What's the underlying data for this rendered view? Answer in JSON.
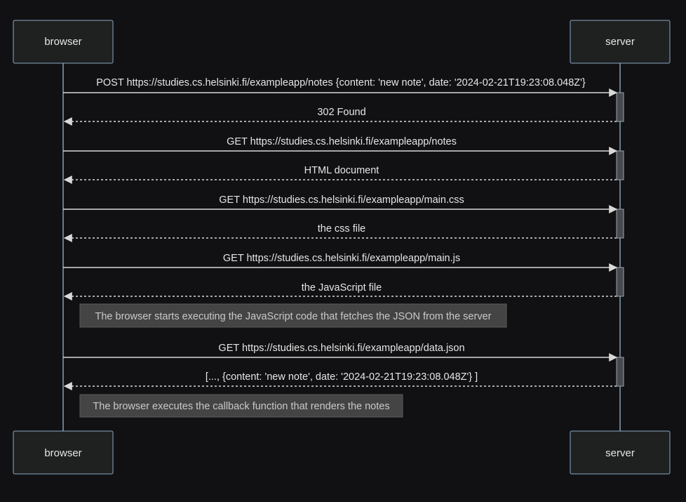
{
  "actors": {
    "left": "browser",
    "right": "server"
  },
  "messages": [
    {
      "text": "POST https://studies.cs.helsinki.fi/exampleapp/notes {content: 'new note', date: '2024-02-21T19:23:08.048Z'}",
      "direction": "request"
    },
    {
      "text": "302 Found",
      "direction": "response"
    },
    {
      "text": "GET https://studies.cs.helsinki.fi/exampleapp/notes",
      "direction": "request"
    },
    {
      "text": "HTML document",
      "direction": "response"
    },
    {
      "text": "GET https://studies.cs.helsinki.fi/exampleapp/main.css",
      "direction": "request"
    },
    {
      "text": "the css file",
      "direction": "response"
    },
    {
      "text": "GET https://studies.cs.helsinki.fi/exampleapp/main.js",
      "direction": "request"
    },
    {
      "text": "the JavaScript file",
      "direction": "response"
    },
    {
      "text": "GET https://studies.cs.helsinki.fi/exampleapp/data.json",
      "direction": "request"
    },
    {
      "text": "[..., {content: 'new note', date: '2024-02-21T19:23:08.048Z'} ]",
      "direction": "response"
    }
  ],
  "notes": [
    {
      "text": "The browser starts executing the JavaScript code that fetches the JSON from the server"
    },
    {
      "text": "The browser executes the callback function that renders the notes"
    }
  ],
  "colors": {
    "background": "#111113",
    "lifeline": "#8aa9c4",
    "arrow": "#d9d9d9",
    "note_fill": "#444444",
    "activation_fill": "#474b50"
  }
}
